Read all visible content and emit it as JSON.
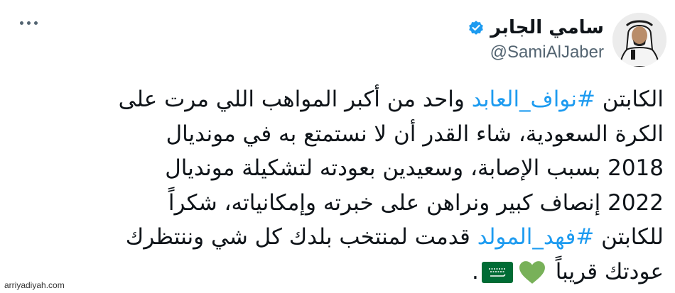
{
  "author": {
    "name": "سامي الجابر",
    "handle": "@SamiAlJaber",
    "verified": true
  },
  "more_icon": "more-horizontal-icon",
  "tweet": {
    "l1_hashtag": "#نواف_العابد",
    "l1_pre": "الكابتن ",
    "l1_post": " واحد من أكبر المواهب اللي مرت على",
    "l2": "الكرة السعودية، شاء القدر أن لا نستمتع به في مونديال",
    "l3": "2018 بسبب الإصابة، وسعيدين بعودته لتشكيلة مونديال",
    "l4": "2022 إنصاف كبير ونراهن على خبرته وإمكانياته، شكراً",
    "l5_pre": "للكابتن ",
    "l5_hashtag": "#فهد_المولد",
    "l5_post": " قدمت لمنتخب بلدك كل شي وننتظرك",
    "l6_text": "عودتك قريباً",
    "l6_end": "."
  },
  "emojis": [
    "green-heart-icon",
    "saudi-flag-icon"
  ],
  "colors": {
    "hashtag": "#1d9bf0",
    "text": "#0f1419",
    "secondary": "#536471",
    "verified": "#1d9bf0",
    "heart": "#78b159",
    "flag": "#006c35"
  },
  "watermark": "arriyadiyah.com"
}
